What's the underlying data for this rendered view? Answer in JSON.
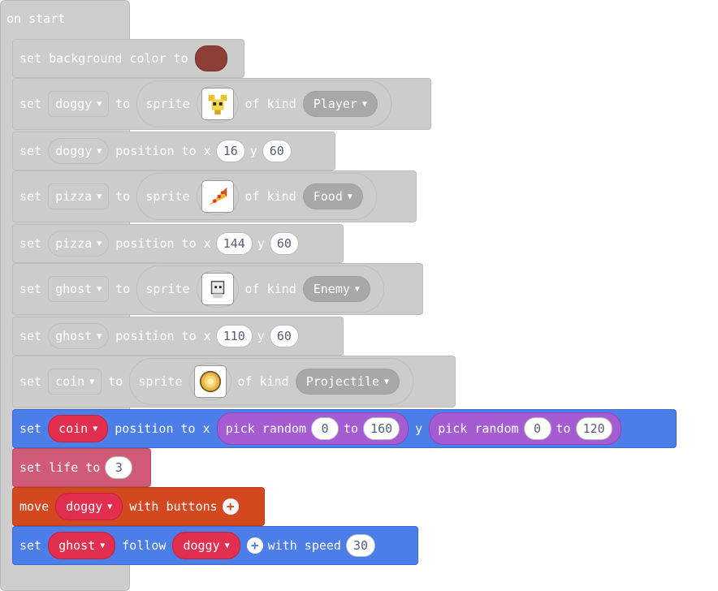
{
  "on_start": {
    "label": "on start"
  },
  "bg": {
    "set": "set background color to",
    "swatch": "#8c3e37"
  },
  "blocks": {
    "doggy_sprite": {
      "set": "set",
      "var": "doggy",
      "to": "to",
      "sprite": "sprite",
      "of_kind": "of kind",
      "kind": "Player"
    },
    "doggy_pos": {
      "set": "set",
      "var": "doggy",
      "pos": "position to x",
      "x": "16",
      "y_label": "y",
      "y": "60"
    },
    "pizza_sprite": {
      "set": "set",
      "var": "pizza",
      "to": "to",
      "sprite": "sprite",
      "of_kind": "of kind",
      "kind": "Food"
    },
    "pizza_pos": {
      "set": "set",
      "var": "pizza",
      "pos": "position to x",
      "x": "144",
      "y_label": "y",
      "y": "60"
    },
    "ghost_sprite": {
      "set": "set",
      "var": "ghost",
      "to": "to",
      "sprite": "sprite",
      "of_kind": "of kind",
      "kind": "Enemy"
    },
    "ghost_pos": {
      "set": "set",
      "var": "ghost",
      "pos": "position to x",
      "x": "110",
      "y_label": "y",
      "y": "60"
    },
    "coin_sprite": {
      "set": "set",
      "var": "coin",
      "to": "to",
      "sprite": "sprite",
      "of_kind": "of kind",
      "kind": "Projectile"
    },
    "coin_pos": {
      "set": "set",
      "var": "coin",
      "pos": "position to x",
      "pick1": "pick random",
      "a1": "0",
      "to1": "to",
      "b1": "160",
      "y_label": "y",
      "pick2": "pick random",
      "a2": "0",
      "to2": "to",
      "b2": "120"
    },
    "life": {
      "label": "set life to",
      "value": "3"
    },
    "move": {
      "move": "move",
      "var": "doggy",
      "with": "with buttons"
    },
    "follow": {
      "set": "set",
      "var": "ghost",
      "follow": "follow",
      "target": "doggy",
      "with_speed": "with speed",
      "speed": "30"
    }
  },
  "icons": {
    "dropdown": "chevron-down-icon",
    "plus": "plus-circle-icon"
  }
}
